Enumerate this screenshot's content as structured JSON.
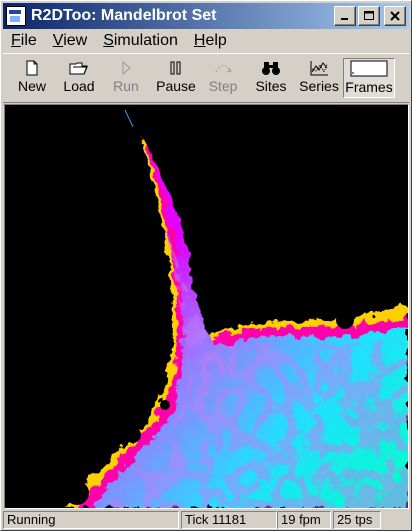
{
  "window": {
    "title": "R2DToo: Mandelbrot Set"
  },
  "title_buttons": {
    "minimize": "minimize-icon",
    "maximize": "maximize-icon",
    "close": "close-icon"
  },
  "menu": {
    "file": {
      "accel": "F",
      "rest": "ile"
    },
    "view": {
      "accel": "V",
      "rest": "iew"
    },
    "simulation": {
      "accel": "S",
      "rest": "imulation"
    },
    "help": {
      "accel": "H",
      "rest": "elp"
    }
  },
  "toolbar": {
    "new": {
      "label": "New",
      "icon": "new-document-icon"
    },
    "load": {
      "label": "Load",
      "icon": "open-folder-icon"
    },
    "run": {
      "label": "Run",
      "icon": "play-icon",
      "disabled": true
    },
    "pause": {
      "label": "Pause",
      "icon": "pause-icon"
    },
    "step": {
      "label": "Step",
      "icon": "step-icon",
      "disabled": true
    },
    "sites": {
      "label": "Sites",
      "icon": "binoculars-icon"
    },
    "series": {
      "label": "Series",
      "icon": "chart-icon"
    },
    "frames": {
      "label": "Frames",
      "icon": "frames-icon",
      "pressed": true
    }
  },
  "canvas": {
    "content": "Mandelbrot set fractal view"
  },
  "status": {
    "state": "Running",
    "tick": "Tick 11181",
    "fpm": "19 fpm",
    "tps": "25 tps"
  },
  "colors": {
    "title_start": "#0a246a",
    "title_end": "#a6caf0",
    "chrome": "#d4d0c8"
  }
}
